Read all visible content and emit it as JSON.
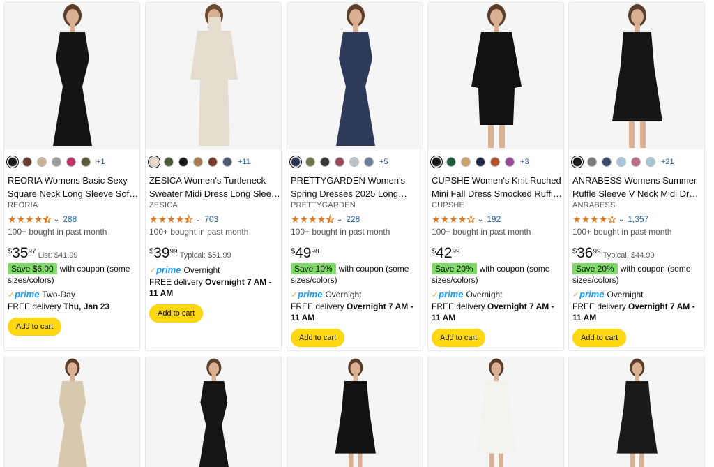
{
  "products": [
    {
      "title": "REORIA Womens Basic Sexy Square Neck Long Sleeve Sof…",
      "brand": "REORIA",
      "swatches": [
        "#1a1a1a",
        "#6b3a2e",
        "#c8b39a",
        "#9c9c9c",
        "#c1346b",
        "#5c5a3c"
      ],
      "more_colors": "+1",
      "rating": 4.5,
      "reviews": "288",
      "bought": "100+ bought in past month",
      "price_currency": "$",
      "price_whole": "35",
      "price_fraction": "97",
      "list_label": "List:",
      "list_price": "$41.99",
      "coupon_badge": "Save $6.00",
      "coupon_text": "with coupon (some sizes/colors)",
      "prime_label": "prime",
      "prime_speed": "Two-Day",
      "delivery_prefix": "FREE delivery ",
      "delivery_bold": "Thu, Jan 23",
      "cart_label": "Add to cart"
    },
    {
      "title": "ZESICA Women's Turtleneck Sweater Midi Dress Long Slee…",
      "brand": "ZESICA",
      "swatches": [
        "#e8d9c8",
        "#4f5a3c",
        "#1a1a1a",
        "#a87a52",
        "#7a3a2a",
        "#4d5c75"
      ],
      "more_colors": "+11",
      "rating": 4.5,
      "reviews": "703",
      "bought": "100+ bought in past month",
      "price_currency": "$",
      "price_whole": "39",
      "price_fraction": "99",
      "list_label": "Typical:",
      "list_price": "$51.99",
      "coupon_badge": "",
      "coupon_text": "",
      "prime_label": "prime",
      "prime_speed": "Overnight",
      "delivery_prefix": "FREE delivery ",
      "delivery_bold": "Overnight 7 AM - 11 AM",
      "cart_label": "Add to cart"
    },
    {
      "title": "PRETTYGARDEN Women's Spring Dresses 2025 Long…",
      "brand": "PRETTYGARDEN",
      "swatches": [
        "#2b3554",
        "#6f7a4a",
        "#3a3a3a",
        "#9a4a5a",
        "#b8c4cc",
        "#6e7f9c"
      ],
      "more_colors": "+5",
      "rating": 4.5,
      "reviews": "228",
      "bought": "100+ bought in past month",
      "price_currency": "$",
      "price_whole": "49",
      "price_fraction": "98",
      "list_label": "",
      "list_price": "",
      "coupon_badge": "Save 10%",
      "coupon_text": "with coupon (some sizes/colors)",
      "prime_label": "prime",
      "prime_speed": "Overnight",
      "delivery_prefix": "FREE delivery ",
      "delivery_bold": "Overnight 7 AM - 11 AM",
      "cart_label": "Add to cart"
    },
    {
      "title": "CUPSHE Women's Knit Ruched Mini Fall Dress Smocked Ruffl…",
      "brand": "CUPSHE",
      "swatches": [
        "#1a1a1a",
        "#1f5a3a",
        "#c8a46a",
        "#1f2a4a",
        "#b5532a",
        "#9b4a9c"
      ],
      "more_colors": "+3",
      "rating": 4.0,
      "reviews": "192",
      "bought": "100+ bought in past month",
      "price_currency": "$",
      "price_whole": "42",
      "price_fraction": "99",
      "list_label": "",
      "list_price": "",
      "coupon_badge": "Save 20%",
      "coupon_text": "with coupon (some sizes/colors)",
      "prime_label": "prime",
      "prime_speed": "Overnight",
      "delivery_prefix": "FREE delivery ",
      "delivery_bold": "Overnight 7 AM - 11 AM",
      "cart_label": "Add to cart"
    },
    {
      "title": "ANRABESS Womens Summer Ruffle Sleeve V Neck Midi Dr…",
      "brand": "ANRABESS",
      "swatches": [
        "#1a1a1a",
        "#7a7a7a",
        "#3a4a6a",
        "#a9c4dc",
        "#c06a8a",
        "#a8c8d8"
      ],
      "more_colors": "+21",
      "rating": 4.0,
      "reviews": "1,357",
      "bought": "100+ bought in past month",
      "price_currency": "$",
      "price_whole": "36",
      "price_fraction": "99",
      "list_label": "Typical:",
      "list_price": "$44.99",
      "coupon_badge": "Save 20%",
      "coupon_text": "with coupon (some sizes/colors)",
      "prime_label": "prime",
      "prime_speed": "Overnight",
      "delivery_prefix": "FREE delivery ",
      "delivery_bold": "Overnight 7 AM - 11 AM",
      "cart_label": "Add to cart"
    }
  ],
  "colors": {
    "star": "#de7921",
    "link": "#2162a1",
    "coupon_bg": "#7fda69",
    "cart_btn": "#ffd814",
    "prime_blue": "#1399ff",
    "prime_check": "#f3a847"
  }
}
